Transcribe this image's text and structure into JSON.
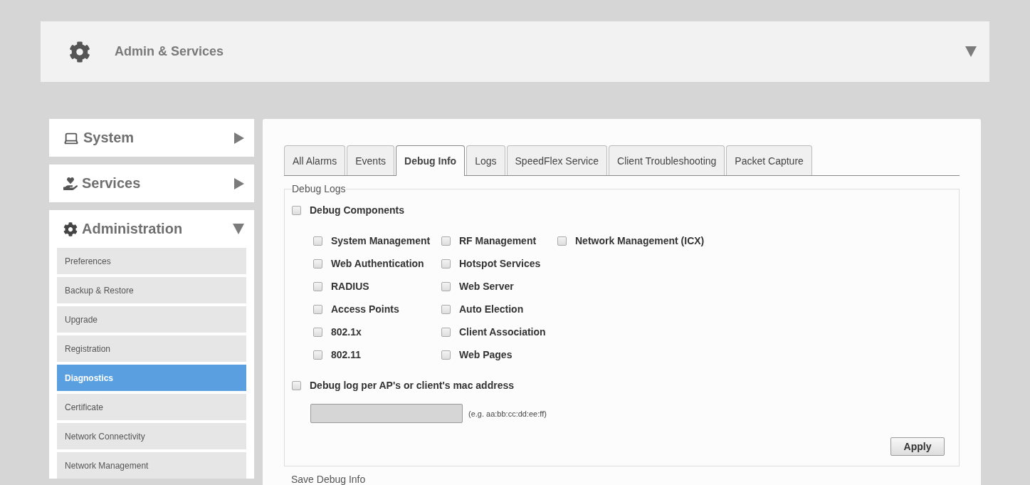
{
  "header": {
    "title": "Admin & Services",
    "expanded": true
  },
  "sidebar": {
    "sections": [
      {
        "label": "System",
        "expanded": false
      },
      {
        "label": "Services",
        "expanded": false
      },
      {
        "label": "Administration",
        "expanded": true,
        "items": [
          {
            "label": "Preferences",
            "selected": false
          },
          {
            "label": "Backup & Restore",
            "selected": false
          },
          {
            "label": "Upgrade",
            "selected": false
          },
          {
            "label": "Registration",
            "selected": false
          },
          {
            "label": "Diagnostics",
            "selected": true
          },
          {
            "label": "Certificate",
            "selected": false
          },
          {
            "label": "Network Connectivity",
            "selected": false
          },
          {
            "label": "Network Management",
            "selected": false
          }
        ]
      }
    ]
  },
  "tabs": [
    {
      "label": "All Alarms",
      "selected": false
    },
    {
      "label": "Events",
      "selected": false
    },
    {
      "label": "Debug Info",
      "selected": true
    },
    {
      "label": "Logs",
      "selected": false
    },
    {
      "label": "SpeedFlex Service",
      "selected": false
    },
    {
      "label": "Client Troubleshooting",
      "selected": false
    },
    {
      "label": "Packet Capture",
      "selected": false
    }
  ],
  "debug_logs": {
    "legend": "Debug Logs",
    "debug_components": {
      "label": "Debug Components",
      "checked": false
    },
    "components": [
      [
        {
          "label": "System Management",
          "checked": false
        },
        {
          "label": "RF Management",
          "checked": false
        },
        {
          "label": "Network Management (ICX)",
          "checked": false
        }
      ],
      [
        {
          "label": "Web Authentication",
          "checked": false
        },
        {
          "label": "Hotspot Services",
          "checked": false
        }
      ],
      [
        {
          "label": "RADIUS",
          "checked": false
        },
        {
          "label": "Web Server",
          "checked": false
        }
      ],
      [
        {
          "label": "Access Points",
          "checked": false
        },
        {
          "label": "Auto Election",
          "checked": false
        }
      ],
      [
        {
          "label": "802.1x",
          "checked": false
        },
        {
          "label": "Client Association",
          "checked": false
        }
      ],
      [
        {
          "label": "802.11",
          "checked": false
        },
        {
          "label": "Web Pages",
          "checked": false
        }
      ]
    ],
    "mac_debug": {
      "label": "Debug log per AP's or client's mac address",
      "checked": false
    },
    "mac_hint": "(e.g. aa:bb:cc:dd:ee:ff)",
    "apply": "Apply"
  },
  "next_section": "Save Debug Info"
}
